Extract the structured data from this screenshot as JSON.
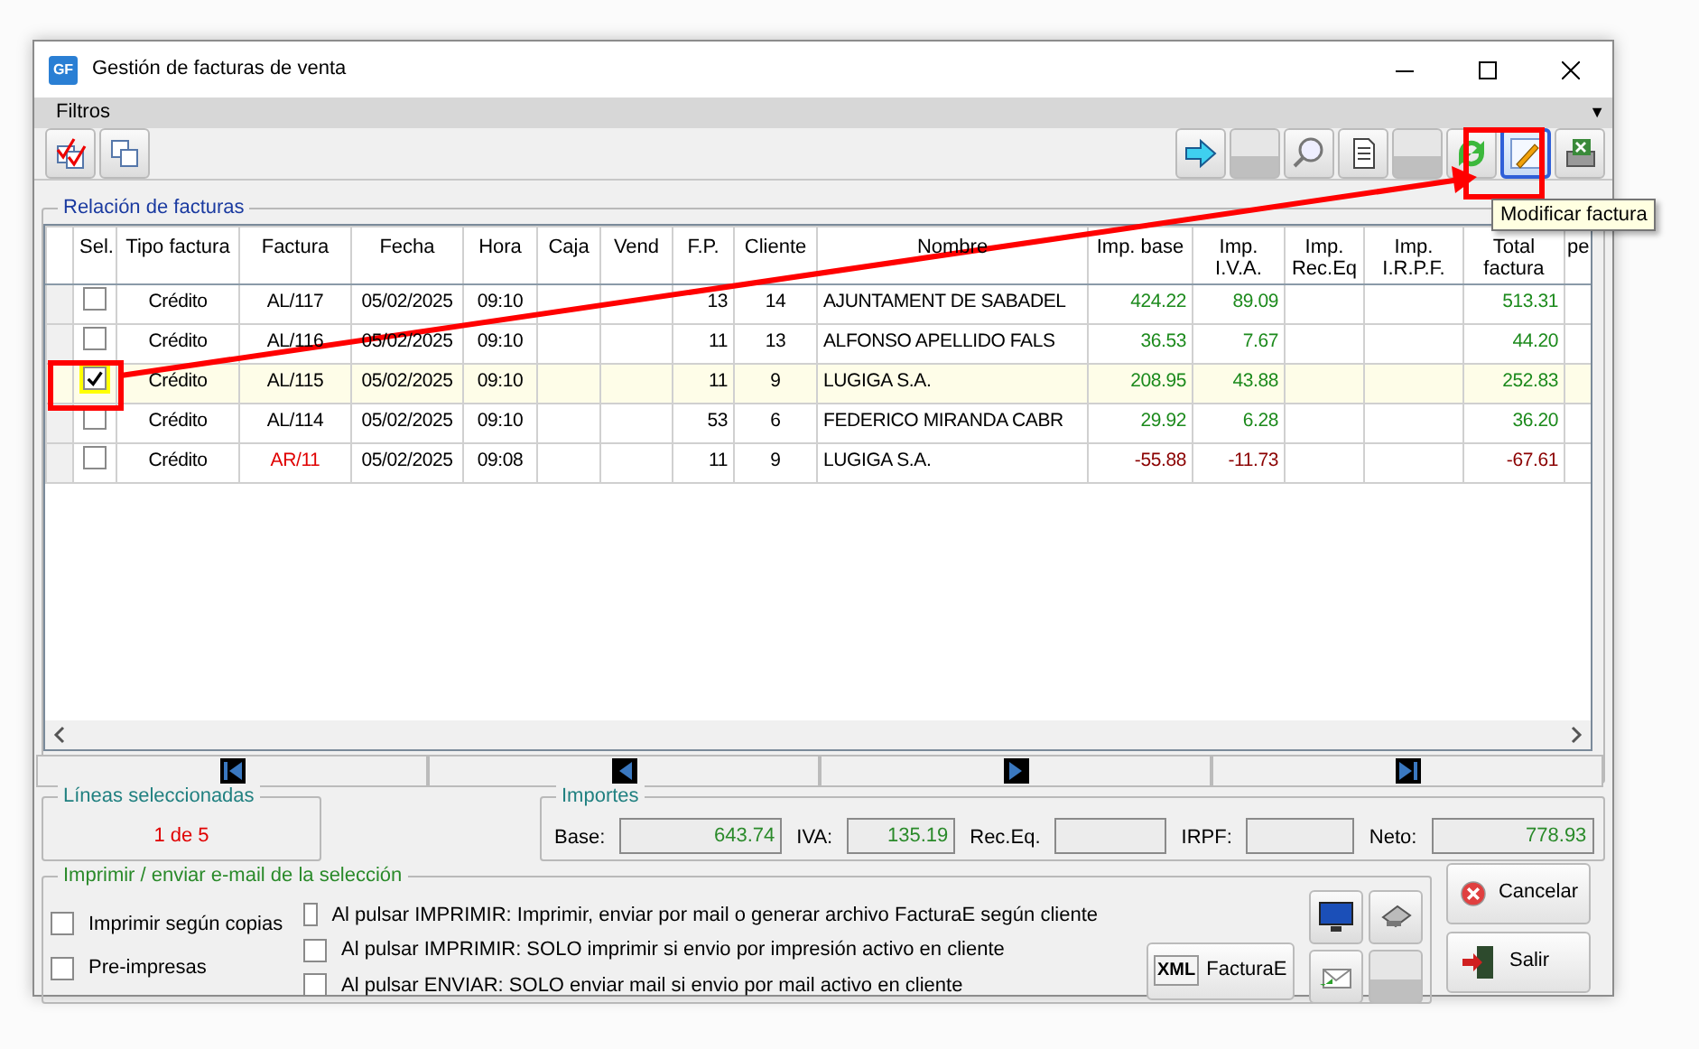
{
  "window": {
    "title": "Gestión de facturas de venta",
    "app_icon": "GF"
  },
  "filter_bar": {
    "label": "Filtros",
    "arrow": "▼"
  },
  "toolbar_left": [
    {
      "kind": "check-all"
    },
    {
      "kind": "uncheck-all"
    }
  ],
  "toolbar_right": [
    {
      "kind": "arrow",
      "selected": false
    },
    {
      "kind": "blank",
      "selected": false
    },
    {
      "kind": "search",
      "selected": false
    },
    {
      "kind": "document",
      "selected": false
    },
    {
      "kind": "blank",
      "selected": false
    },
    {
      "kind": "refresh",
      "selected": false
    },
    {
      "kind": "edit",
      "selected": true
    },
    {
      "kind": "export",
      "selected": false
    }
  ],
  "tooltip": "Modificar factura",
  "table": {
    "title": "Relación de facturas",
    "columns": [
      "Sel.",
      "Tipo factura",
      "Factura",
      "Fecha",
      "Hora",
      "Caja",
      "Vend",
      "F.P.",
      "Cliente",
      "Nombre",
      "Imp. base",
      "Imp.\nI.V.A.",
      "Imp.\nRec.Eq",
      "Imp.\nI.R.P.F.",
      "Total\nfactura",
      "pe"
    ],
    "rows": [
      {
        "checked": false,
        "selected": false,
        "negative": false,
        "cells": [
          "",
          "Crédito",
          "AL/117",
          "05/02/2025",
          "09:10",
          "",
          "",
          "13",
          "14",
          "AJUNTAMENT DE SABADEL",
          "424.22",
          "89.09",
          "",
          "",
          "513.31"
        ]
      },
      {
        "checked": false,
        "selected": false,
        "negative": false,
        "cells": [
          "",
          "Crédito",
          "AL/116",
          "05/02/2025",
          "09:10",
          "",
          "",
          "11",
          "13",
          "ALFONSO APELLIDO FALS",
          "36.53",
          "7.67",
          "",
          "",
          "44.20"
        ]
      },
      {
        "checked": true,
        "selected": true,
        "negative": false,
        "cells": [
          "",
          "Crédito",
          "AL/115",
          "05/02/2025",
          "09:10",
          "",
          "",
          "11",
          "9",
          "LUGIGA S.A.",
          "208.95",
          "43.88",
          "",
          "",
          "252.83"
        ]
      },
      {
        "checked": false,
        "selected": false,
        "negative": false,
        "cells": [
          "",
          "Crédito",
          "AL/114",
          "05/02/2025",
          "09:10",
          "",
          "",
          "53",
          "6",
          "FEDERICO MIRANDA CABR",
          "29.92",
          "6.28",
          "",
          "",
          "36.20"
        ]
      },
      {
        "checked": false,
        "selected": false,
        "negative": true,
        "cells": [
          "",
          "Crédito",
          "AR/11",
          "05/02/2025",
          "09:08",
          "",
          "",
          "11",
          "9",
          "LUGIGA S.A.",
          "-55.88",
          "-11.73",
          "",
          "",
          "-67.61"
        ]
      }
    ]
  },
  "navigator": [
    {
      "kind": "first"
    },
    {
      "kind": "prev"
    },
    {
      "kind": "next"
    },
    {
      "kind": "last"
    }
  ],
  "selected_lines": {
    "title": "Líneas seleccionadas",
    "value": "1 de 5"
  },
  "totals": {
    "title": "Importes",
    "fields": [
      {
        "label": "Base:",
        "value": "643.74"
      },
      {
        "label": "IVA:",
        "value": "135.19"
      },
      {
        "label": "Rec.Eq."
      },
      {
        "label": "IRPF:"
      },
      {
        "label": "Neto:",
        "value": "778.93"
      }
    ]
  },
  "print_section": {
    "title": "Imprimir / enviar e-mail de la selección",
    "left_options": [
      {
        "label": "Imprimir según copias",
        "checked": false
      },
      {
        "label": "Pre-impresas",
        "checked": false
      }
    ],
    "right_options": [
      {
        "label": "Al pulsar IMPRIMIR: Imprimir, enviar por mail o generar archivo FacturaE según cliente",
        "checked": false
      },
      {
        "label": "Al pulsar IMPRIMIR: SOLO imprimir si envio por impresión activo en cliente",
        "checked": false
      },
      {
        "label": "Al pulsar ENVIAR: SOLO enviar mail si envio por mail activo en cliente",
        "checked": false
      }
    ],
    "facturae_button": "FacturaE",
    "xml_tag": "XML"
  },
  "buttons": [
    "Cancelar",
    "Salir"
  ]
}
